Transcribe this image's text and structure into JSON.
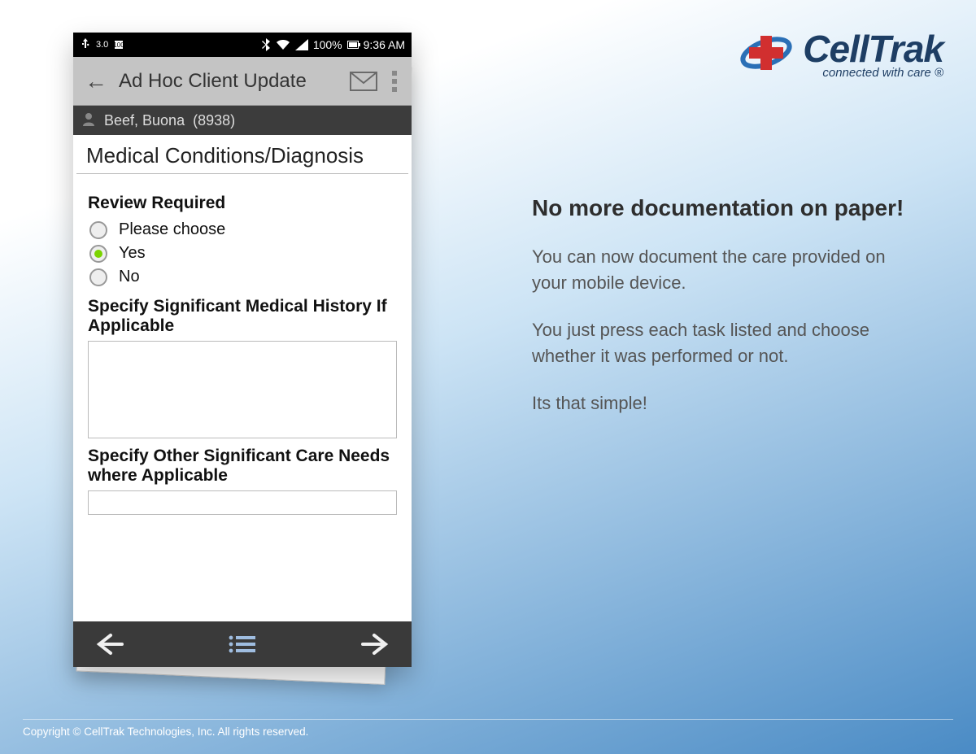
{
  "brand": {
    "name": "CellTrak",
    "tagline": "connected with care ®"
  },
  "marketing": {
    "heading": "No more documentation on paper!",
    "p1": "You can now document the care provided on your mobile device.",
    "p2": "You just press each task listed and choose whether it was performed or not.",
    "p3": "Its that simple!"
  },
  "statusbar": {
    "usb_label": "3.0",
    "battery_pct": "100%",
    "time": "9:36 AM"
  },
  "appheader": {
    "title": "Ad Hoc Client Update"
  },
  "client": {
    "name": "Beef, Buona",
    "id": "(8938)"
  },
  "section_title": "Medical Conditions/Diagnosis",
  "review": {
    "label": "Review Required",
    "options": [
      "Please choose",
      "Yes",
      "No"
    ],
    "selected_index": 1
  },
  "history": {
    "label": "Specify Significant Medical History If Applicable",
    "value": ""
  },
  "careneeds": {
    "label": "Specify Other Significant Care Needs where Applicable",
    "value": ""
  },
  "copyright": "Copyright © CellTrak Technologies, Inc. All rights reserved."
}
